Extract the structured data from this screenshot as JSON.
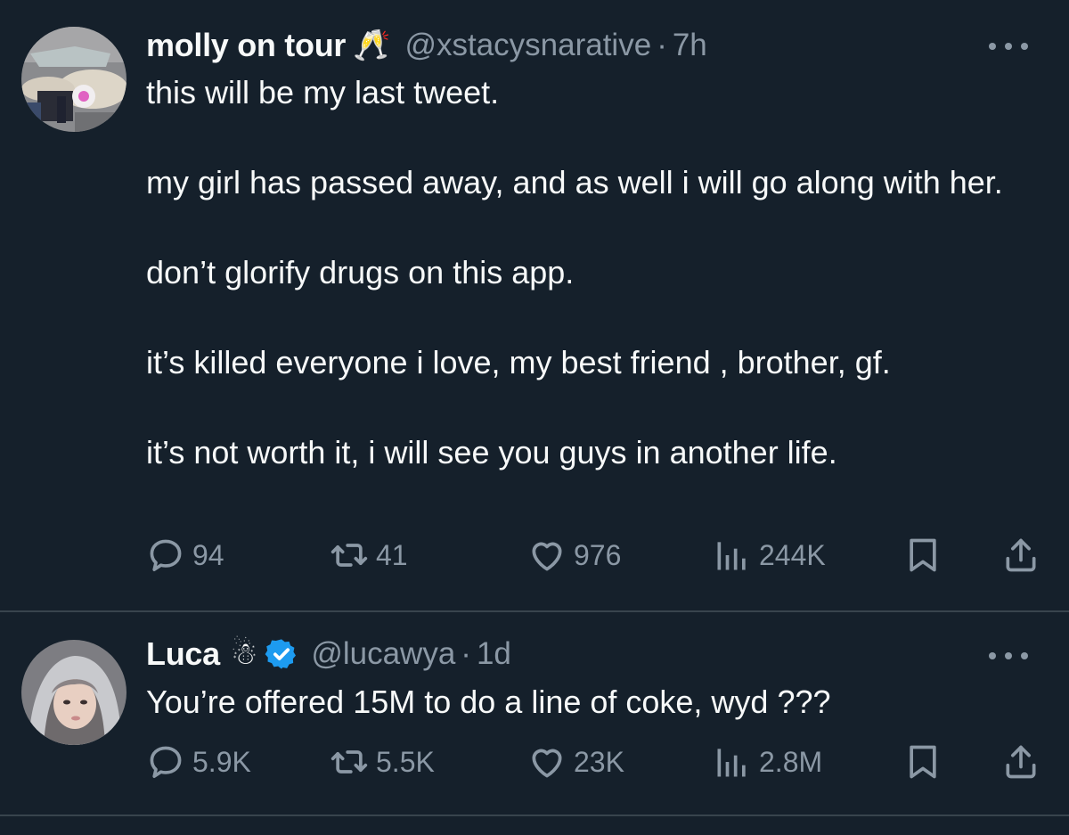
{
  "tweets": [
    {
      "author": {
        "name": "molly on tour",
        "emoji": "🥂",
        "handle": "@xstacysnarative",
        "verified": false
      },
      "separator": "·",
      "time": "7h",
      "paragraphs": [
        "this will be my last tweet.",
        "my girl has passed away, and as well i will go along with her.",
        "don’t glorify drugs on this app.",
        "it’s killed everyone i love, my best friend , brother, gf.",
        "it’s not worth it, i will see you guys in another life."
      ],
      "stats": {
        "replies": "94",
        "retweets": "41",
        "likes": "976",
        "views": "244K"
      }
    },
    {
      "author": {
        "name": "Luca",
        "emoji": "☃",
        "handle": "@lucawya",
        "verified": true
      },
      "separator": "·",
      "time": "1d",
      "paragraphs": [
        "You’re offered 15M to do a line of coke, wyd ???"
      ],
      "stats": {
        "replies": "5.9K",
        "retweets": "5.5K",
        "likes": "23K",
        "views": "2.8M"
      }
    }
  ],
  "colors": {
    "background": "#15202b",
    "text": "#f7f9f9",
    "secondary": "#8b98a5",
    "verified": "#1d9bf0",
    "divider": "#38444d"
  },
  "icons": [
    "reply-icon",
    "retweet-icon",
    "like-icon",
    "views-icon",
    "bookmark-icon",
    "share-icon",
    "more-icon",
    "verified-badge-icon"
  ]
}
